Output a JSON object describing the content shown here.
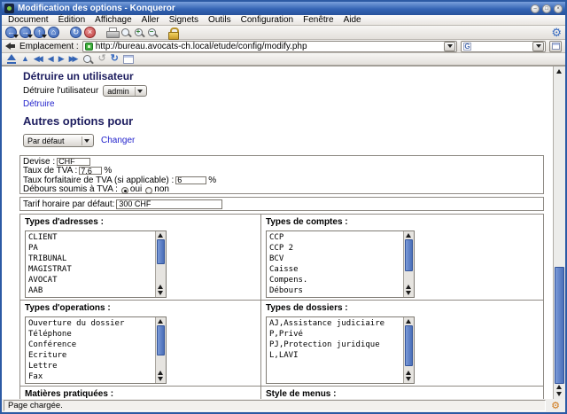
{
  "window": {
    "title": "Modification des options - Konqueror",
    "controls": [
      {
        "name": "minimize",
        "glyph": "–"
      },
      {
        "name": "maximize",
        "glyph": "□"
      },
      {
        "name": "close",
        "glyph": "×"
      }
    ]
  },
  "menu": {
    "items": [
      {
        "label": "Document"
      },
      {
        "label": "Édition"
      },
      {
        "label": "Affichage"
      },
      {
        "label": "Aller"
      },
      {
        "label": "Signets"
      },
      {
        "label": "Outils"
      },
      {
        "label": "Configuration"
      },
      {
        "label": "Fenêtre"
      },
      {
        "label": "Aide"
      }
    ]
  },
  "toolbar": {
    "items": [
      {
        "name": "back-icon",
        "glyph": "←"
      },
      {
        "name": "forward-icon",
        "glyph": "→"
      },
      {
        "name": "up-icon",
        "glyph": "↑"
      },
      {
        "name": "home-icon",
        "glyph": "⌂"
      },
      {
        "name": "reload-icon",
        "glyph": "↻"
      },
      {
        "name": "stop-icon",
        "glyph": "×"
      },
      {
        "name": "print-icon",
        "glyph": ""
      },
      {
        "name": "find-icon",
        "glyph": ""
      },
      {
        "name": "zoom-in-icon",
        "glyph": "+"
      },
      {
        "name": "zoom-out-icon",
        "glyph": "−"
      },
      {
        "name": "lock-icon",
        "glyph": ""
      }
    ],
    "throbber_glyph": "⚙"
  },
  "location": {
    "label": "Emplacement :",
    "url": "http://bureau.avocats-ch.local/etude/config/modify.php",
    "search_engine_label": "G"
  },
  "navbar": {
    "items": [
      {
        "name": "top-icon",
        "glyph": ""
      },
      {
        "name": "up-arrow-icon",
        "glyph": "▲"
      },
      {
        "name": "first-icon",
        "glyph": "◀◀"
      },
      {
        "name": "previous-icon",
        "glyph": "◀"
      },
      {
        "name": "next-icon",
        "glyph": "▶"
      },
      {
        "name": "last-icon",
        "glyph": "▶▶"
      },
      {
        "name": "search-icon",
        "glyph": ""
      },
      {
        "name": "history-icon",
        "glyph": "↺"
      },
      {
        "name": "refresh-icon",
        "glyph": "↻"
      },
      {
        "name": "window-icon",
        "glyph": ""
      }
    ]
  },
  "page": {
    "heading_destroy": "Détruire un utilisateur",
    "destroy_user_label": "Détruire l'utilisateur",
    "user_selected": "admin",
    "destroy_link": "Détruire",
    "heading_options": "Autres options pour",
    "profile_selected": "Par défaut",
    "change_link": "Changer",
    "options": {
      "currency_label": "Devise :",
      "currency_value": "CHF",
      "vat_label": "Taux de TVA :",
      "vat_value": "7.6",
      "vat_unit": "%",
      "flat_vat_label": "Taux forfaitaire de TVA (si applicable) :",
      "flat_vat_value": "6",
      "flat_vat_unit": "%",
      "disbursement_label": "Débours soumis à TVA :",
      "yes_label": "oui",
      "no_label": "non",
      "hourly_rate_label": "Tarif horaire par défaut:",
      "hourly_rate_value": "300 CHF"
    },
    "sections": [
      {
        "title": "Types d'adresses :",
        "items": [
          "CLIENT",
          "PA",
          "TRIBUNAL",
          "MAGISTRAT",
          "AVOCAT",
          "AAB"
        ]
      },
      {
        "title": "Types de comptes :",
        "items": [
          "CCP",
          "CCP 2",
          "BCV",
          "Caisse",
          "Compens.",
          "Débours"
        ]
      },
      {
        "title": "Types d'operations :",
        "items": [
          "Ouverture du dossier",
          "Téléphone",
          "Conférence",
          "Ecriture",
          "Lettre",
          "Fax"
        ]
      },
      {
        "title": "Types de dossiers :",
        "items": [
          "AJ,Assistance judiciaire",
          "P,Privé",
          "PJ,Protection juridique",
          "L,LAVI"
        ]
      },
      {
        "title": "Matières pratiquées :",
        "items": []
      },
      {
        "title": "Style de menus :",
        "items": []
      }
    ]
  },
  "statusbar": {
    "text": "Page chargée.",
    "gear_glyph": "⚙"
  }
}
